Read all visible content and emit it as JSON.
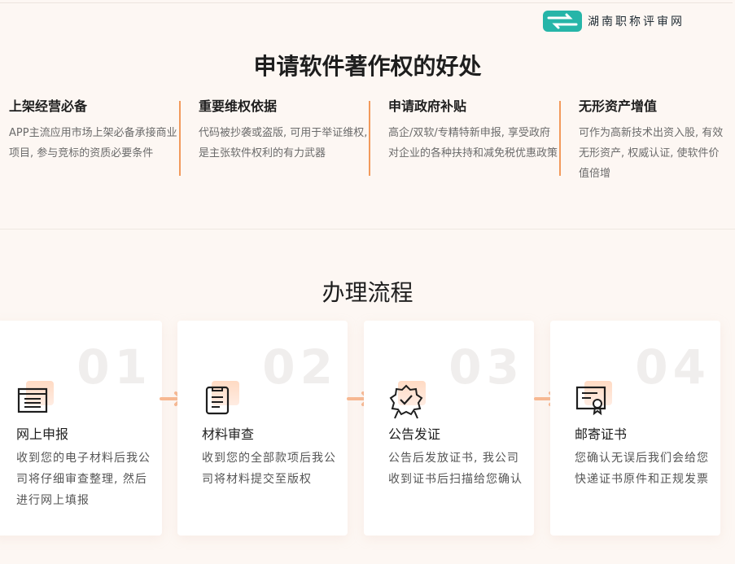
{
  "logo": {
    "text": "湖南职称评审网",
    "icon": "arrows-logo-icon"
  },
  "benefits_section": {
    "title": "申请软件著作权的好处",
    "items": [
      {
        "title": "上架经营必备",
        "desc": "APP主流应用市场上架必备承接商业项目, 参与竞标的资质必要条件"
      },
      {
        "title": "重要维权依据",
        "desc": "代码被抄袭或盗版, 可用于举证维权, 是主张软件权利的有力武器"
      },
      {
        "title": "申请政府补贴",
        "desc": "高企/双软/专精特新申报, 享受政府对企业的各种扶持和减免税优惠政策"
      },
      {
        "title": "无形资产增值",
        "desc": "可作为高新技术出资入股, 有效无形资产, 权威认证, 使软件价值倍增"
      }
    ]
  },
  "process_section": {
    "title": "办理流程",
    "steps": [
      {
        "num": "01",
        "title": "网上申报",
        "desc": "收到您的电子材料后我公司将仔细审查整理, 然后进行网上填报",
        "icon": "document-form-icon"
      },
      {
        "num": "02",
        "title": "材料审查",
        "desc": "收到您的全部款项后我公司将材料提交至版权",
        "icon": "clipboard-icon"
      },
      {
        "num": "03",
        "title": "公告发证",
        "desc": "公告后发放证书, 我公司收到证书后扫描给您确认",
        "icon": "award-badge-icon"
      },
      {
        "num": "04",
        "title": "邮寄证书",
        "desc": "您确认无误后我们会给您快递证书原件和正规发票",
        "icon": "certificate-icon"
      }
    ]
  },
  "colors": {
    "accent": "#f29a5b",
    "background": "#fdf7f3",
    "logo_teal": "#26b5a8"
  }
}
